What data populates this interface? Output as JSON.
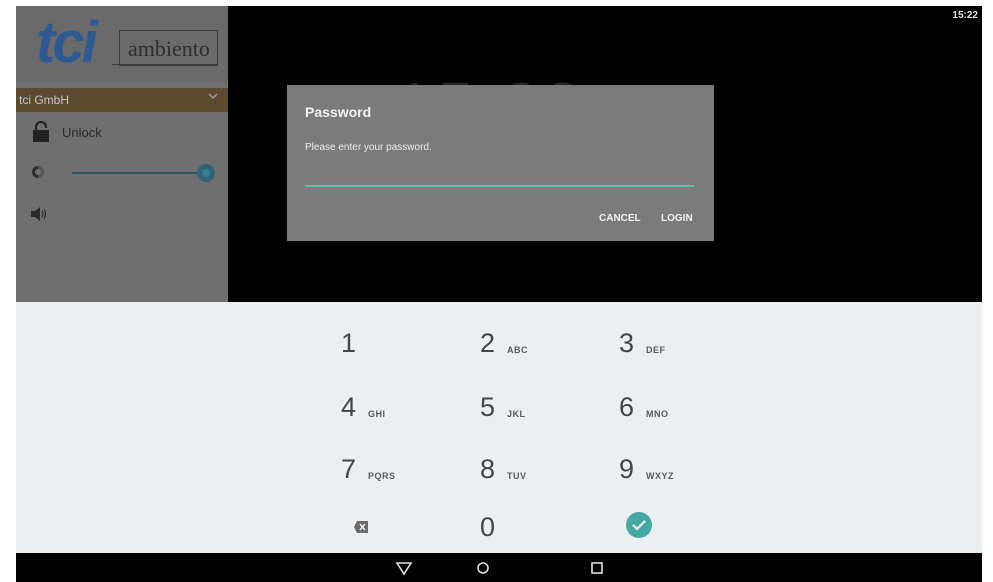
{
  "status_bar": {
    "time": "15:22"
  },
  "drawer": {
    "logo": {
      "brand": "tci",
      "product": "ambiento"
    },
    "account": {
      "name": "tci GmbH"
    },
    "unlock": {
      "label": "Unlock"
    },
    "brightness": {
      "level": 1.0
    }
  },
  "background_clock": "15:22",
  "dialog": {
    "title": "Password",
    "message": "Please enter your password.",
    "password_value": "",
    "cancel_label": "CANCEL",
    "login_label": "LOGIN"
  },
  "keypad": {
    "keys": [
      {
        "num": "1",
        "letters": ""
      },
      {
        "num": "2",
        "letters": "ABC"
      },
      {
        "num": "3",
        "letters": "DEF"
      },
      {
        "num": "4",
        "letters": "GHI"
      },
      {
        "num": "5",
        "letters": "JKL"
      },
      {
        "num": "6",
        "letters": "MNO"
      },
      {
        "num": "7",
        "letters": "PQRS"
      },
      {
        "num": "8",
        "letters": "TUV"
      },
      {
        "num": "9",
        "letters": "WXYZ"
      },
      {
        "num": "0",
        "letters": ""
      }
    ],
    "delete_icon": "backspace-icon",
    "done_icon": "check-circle-icon"
  },
  "navbar": {
    "icons": [
      "back-icon",
      "home-icon",
      "recents-icon"
    ]
  },
  "colors": {
    "accent": "#43a9a2",
    "input_underline": "#6fb8a8",
    "logo_blue": "#2e5a94",
    "dialog_bg": "#7b7b7b",
    "keypad_bg": "#eceff1"
  }
}
